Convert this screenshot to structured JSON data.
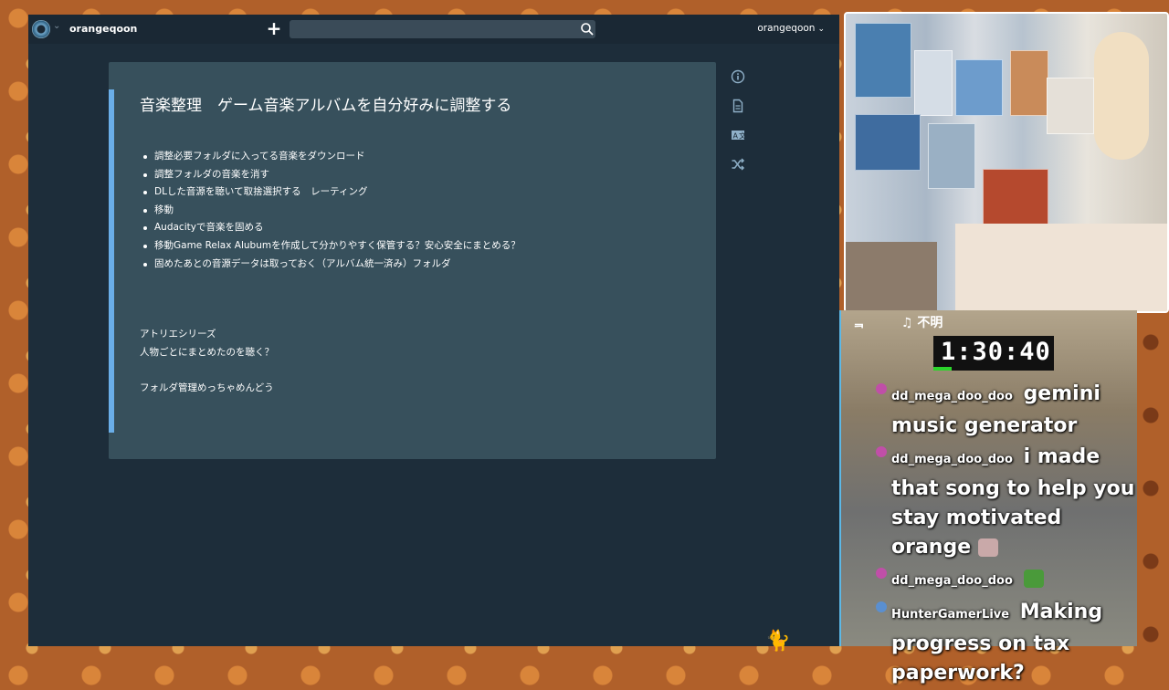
{
  "header": {
    "workspace_name": "orangeqoon",
    "user_name": "orangeqoon",
    "search_placeholder": ""
  },
  "card": {
    "title": "音楽整理　ゲーム音楽アルバムを自分好みに調整する",
    "bullets": [
      "調整必要フォルダに入ってる音楽をダウンロード",
      "調整フォルダの音楽を消す",
      "DLした音源を聴いて取捨選択する　レーティング",
      "移動",
      "Audacityで音楽を固める",
      "移動Game Relax Alubumを作成して分かりやすく保管する？安心安全にまとめる？",
      "固めたあとの音源データは取っておく（アルバム統一済み）フォルダ"
    ],
    "notes": [
      "アトリエシリーズ",
      "人物ごとにまとめたのを聴く？",
      "フォルダ管理めっちゃめんどう"
    ]
  },
  "overlay": {
    "now_playing_left": "ᆿ",
    "now_playing_title": "♫ 不明",
    "timer": "1:30:40",
    "timer_progress": 0.15
  },
  "chat": [
    {
      "user": "dd_mega_doo_doo",
      "text": "gemini music generator",
      "badge_color": "#c04fa8"
    },
    {
      "user": "dd_mega_doo_doo",
      "text": "i made that song to help you stay motivated orange",
      "badge_color": "#c04fa8",
      "emote": "cat-emote"
    },
    {
      "user": "dd_mega_doo_doo",
      "text": "",
      "badge_color": "#c04fa8",
      "emote": "pepe-emote"
    },
    {
      "user": "HunterGamerLive",
      "text": "Making progress on tax paperwork?",
      "badge_color": "#5a8fd0"
    }
  ],
  "colors": {
    "app_bg": "#1d2d3a",
    "card_bg": "#37505c",
    "card_accent": "#6aaee8",
    "timer_bar": "#2bd42b"
  }
}
